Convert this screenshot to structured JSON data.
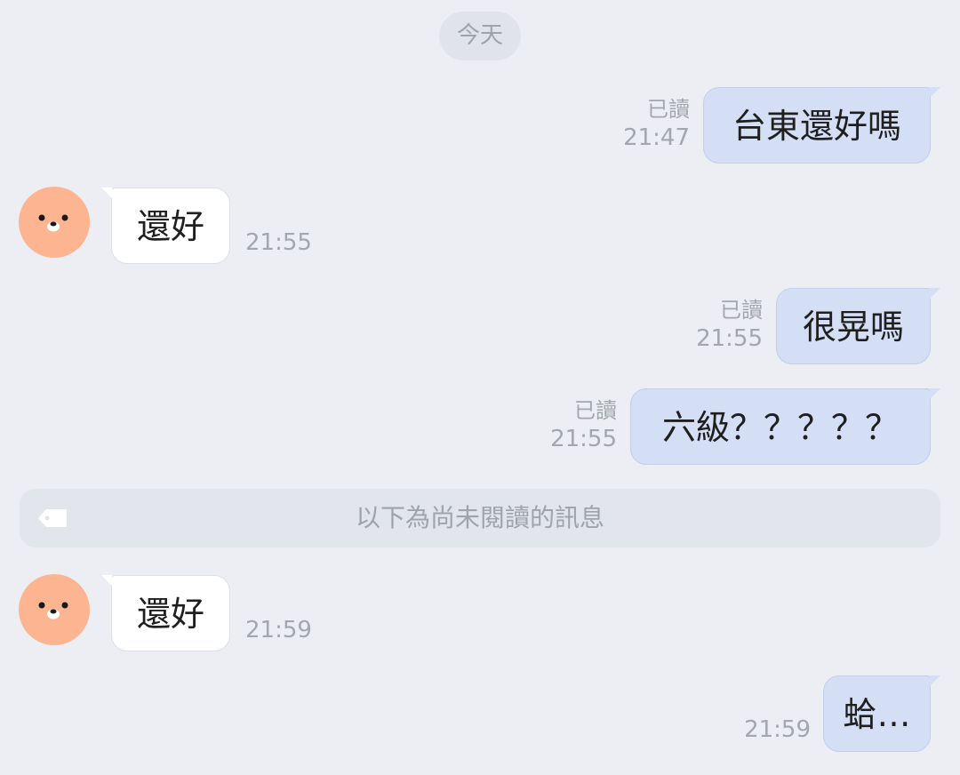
{
  "date_separator": "今天",
  "read_label": "已讀",
  "unread_divider": {
    "text": "以下為尚未閱讀的訊息",
    "icon": "tag-icon"
  },
  "colors": {
    "background": "#eceef3",
    "outgoing_bubble": "#d4dff5",
    "incoming_bubble": "#ffffff",
    "avatar": "#fcb590",
    "meta_text": "#a2a6ae"
  },
  "messages": [
    {
      "direction": "out",
      "text": "台東還好嗎",
      "time": "21:47",
      "read": "已讀"
    },
    {
      "direction": "in",
      "text": "還好",
      "time": "21:55",
      "avatar_icon": "dog-face-icon"
    },
    {
      "direction": "out",
      "text": "很晃嗎",
      "time": "21:55",
      "read": "已讀"
    },
    {
      "direction": "out",
      "text": "六級？？？？？",
      "time": "21:55",
      "read": "已讀"
    },
    {
      "direction": "in",
      "text": "還好",
      "time": "21:59",
      "avatar_icon": "dog-face-icon"
    },
    {
      "direction": "out",
      "text": "蛤…",
      "time": "21:59"
    }
  ]
}
